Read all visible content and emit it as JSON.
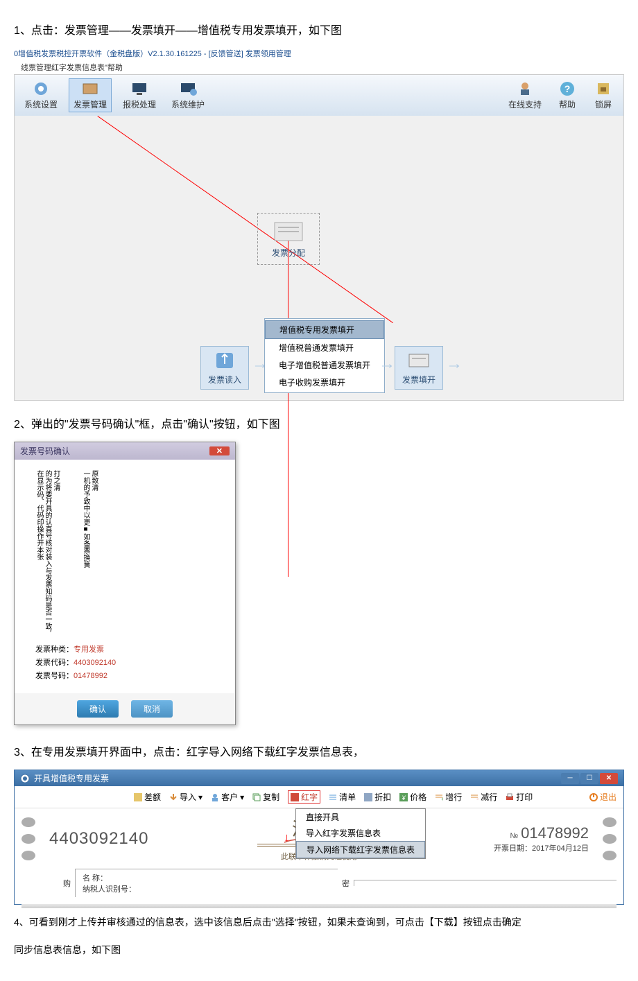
{
  "step1": "1、点击：发票管理——发票填开——增值税专用发票填开，如下图",
  "title_bar": "0增值税发票税控开票软件（金税盘版）V2.1.30.161225 - [反馈管送]  发票领用管理",
  "menu_line": "线票管理红字发票信息表\"帮助",
  "toolbar": {
    "sys": "系统设置",
    "inv_mgmt": "发票管理",
    "tax": "报税处理",
    "maint": "系统维护",
    "online": "在线支持",
    "help": "帮助",
    "lock": "锁屏"
  },
  "box_alloc": "发票分配",
  "box_read": "发票读入",
  "box_fill": "发票填开",
  "popup": {
    "item1": "增值税专用发票填开",
    "item2": "增值税普通发票填开",
    "item3": "电子增值税普通发票填开",
    "item4": "电子收购发票填开"
  },
  "step2": "2、弹出的\"发票号码确认\"框，点击\"确认\"按钮，如下图",
  "dialog": {
    "title": "发票号码确认",
    "body_col1": "在显示码、代码印操作开本张",
    "body_col2": "的为将要开具的认真号核对装入与发票知码是否一致，",
    "body_col3": "打之清",
    "body_col4": "一机的予致中以更■如备票换簧",
    "body_col5": "原致清",
    "kind_label": "发票种类：",
    "kind_value": "专用发票",
    "code_label": "发票代码：",
    "code_value": "4403092140",
    "num_label": "发票号码：",
    "num_value": "01478992",
    "ok": "确认",
    "cancel": "取消"
  },
  "step3": "3、在专用发票填开界面中，点击：红字导入网络下载红字发票信息表，",
  "inv_window": {
    "title": "开具增值税专用发票",
    "tools": {
      "diff": "差额",
      "import": "导入",
      "cust": "客户",
      "copy": "复制",
      "red": "红字",
      "list": "清单",
      "discount": "折扣",
      "price": "价格",
      "addrow": "增行",
      "delrow": "减行",
      "print": "打印",
      "exit": "退出"
    },
    "drop": {
      "m1": "直接开具",
      "m2": "导入红字发票信息表",
      "m3": "导入网络下载红字发票信息表"
    },
    "left_code": "4403092140",
    "sz": "深圳增",
    "bottom_note": "此联不作报销凭证使用",
    "no_prefix": "№",
    "right_no": "01478992",
    "date_line": "开票日期：2017年04月12日",
    "cust_name_lbl": "名    称：",
    "cust_tax_lbl": "纳税人识别号：",
    "gou": "购",
    "mi": "密"
  },
  "step4": "4、可看到刚才上传并审核通过的信息表，选中该信息后点击\"选择\"按钮，如果未查询到，可点击【下载】按钮点击确定",
  "step4b": "同步信息表信息，如下图"
}
